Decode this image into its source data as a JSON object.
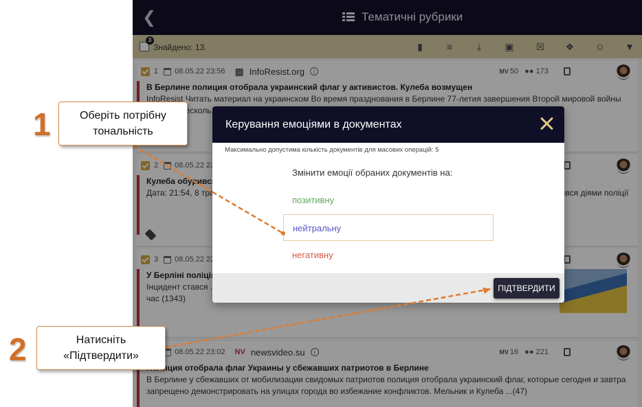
{
  "topbar": {
    "back_glyph": "❮",
    "title": "Тематичні рубрики"
  },
  "toolbar": {
    "selected_count": "3",
    "found_label": "Знайдено: 13.",
    "tools": [
      "document-icon",
      "text-icon",
      "download-icon",
      "save-icon",
      "delete-icon",
      "tag-icon",
      "emotion-icon",
      "filter-icon"
    ]
  },
  "documents": [
    {
      "index": "1",
      "date": "08.05.22 23:56",
      "source": "InfoResist.org",
      "mv": "MV",
      "mv_value": "50",
      "audience": "173",
      "title": "В Берлине полиция отобрала украинский флаг у активистов. Кулеба возмущен",
      "body": "InfoResist Читать материал на украинском Во время празднования в Берлине 77-летия завершения Второй мировой войны полиция несколь..."
    },
    {
      "index": "2",
      "date": "08.05.22 23:",
      "title": "Кулеба обурився",
      "body_left": "Дата: 21:54, 8 тра... в Берліні, яка заб...",
      "body_right": "...рився діями поліції"
    },
    {
      "index": "3",
      "date": "08.05.22 22:",
      "title": "У Берліні поліція",
      "body": "Інцидент стався ... світової війни. Поліція Берліна затримала чоловіка, який ... українські прапори на ... час (1343)"
    },
    {
      "index": "4",
      "date": "08.05.22 23:02",
      "source_logo": "NV",
      "source": "newsvideo.su",
      "mv": "MV",
      "mv_value": "16",
      "audience": "221",
      "title": "Полиция отобрала флаг Украины у сбежавших патриотов в Берлине",
      "body": "В Берлине у сбежавших от мобилизации свидомых патриотов полиция отобрала украинский флаг, которые сегодня и завтра запрещено демонстрировать на улицах города во избежание конфликтов. Мельник и Кулеба ...(47)"
    }
  ],
  "modal": {
    "title": "Керування емоціями в документах",
    "note": "Максимально допустима кількість документів для масових операцій: 5",
    "question": "Змінити емоції обраних документів на:",
    "options": {
      "positive": "позитивну",
      "neutral": "нейтральну",
      "negative": "негативну"
    },
    "confirm": "ПІДТВЕРДИТИ"
  },
  "callouts": {
    "step1_number": "1",
    "step1_text": "Оберіть потрібну тональність",
    "step2_number": "2",
    "step2_text": "Натисніть «Підтвердити»"
  },
  "colors": {
    "topbar": "#14122b",
    "toolbar": "#d9cfa6",
    "accent": "#d0702a",
    "positive": "#5fa85f",
    "neutral": "#5555c8",
    "negative": "#d65a4d"
  }
}
